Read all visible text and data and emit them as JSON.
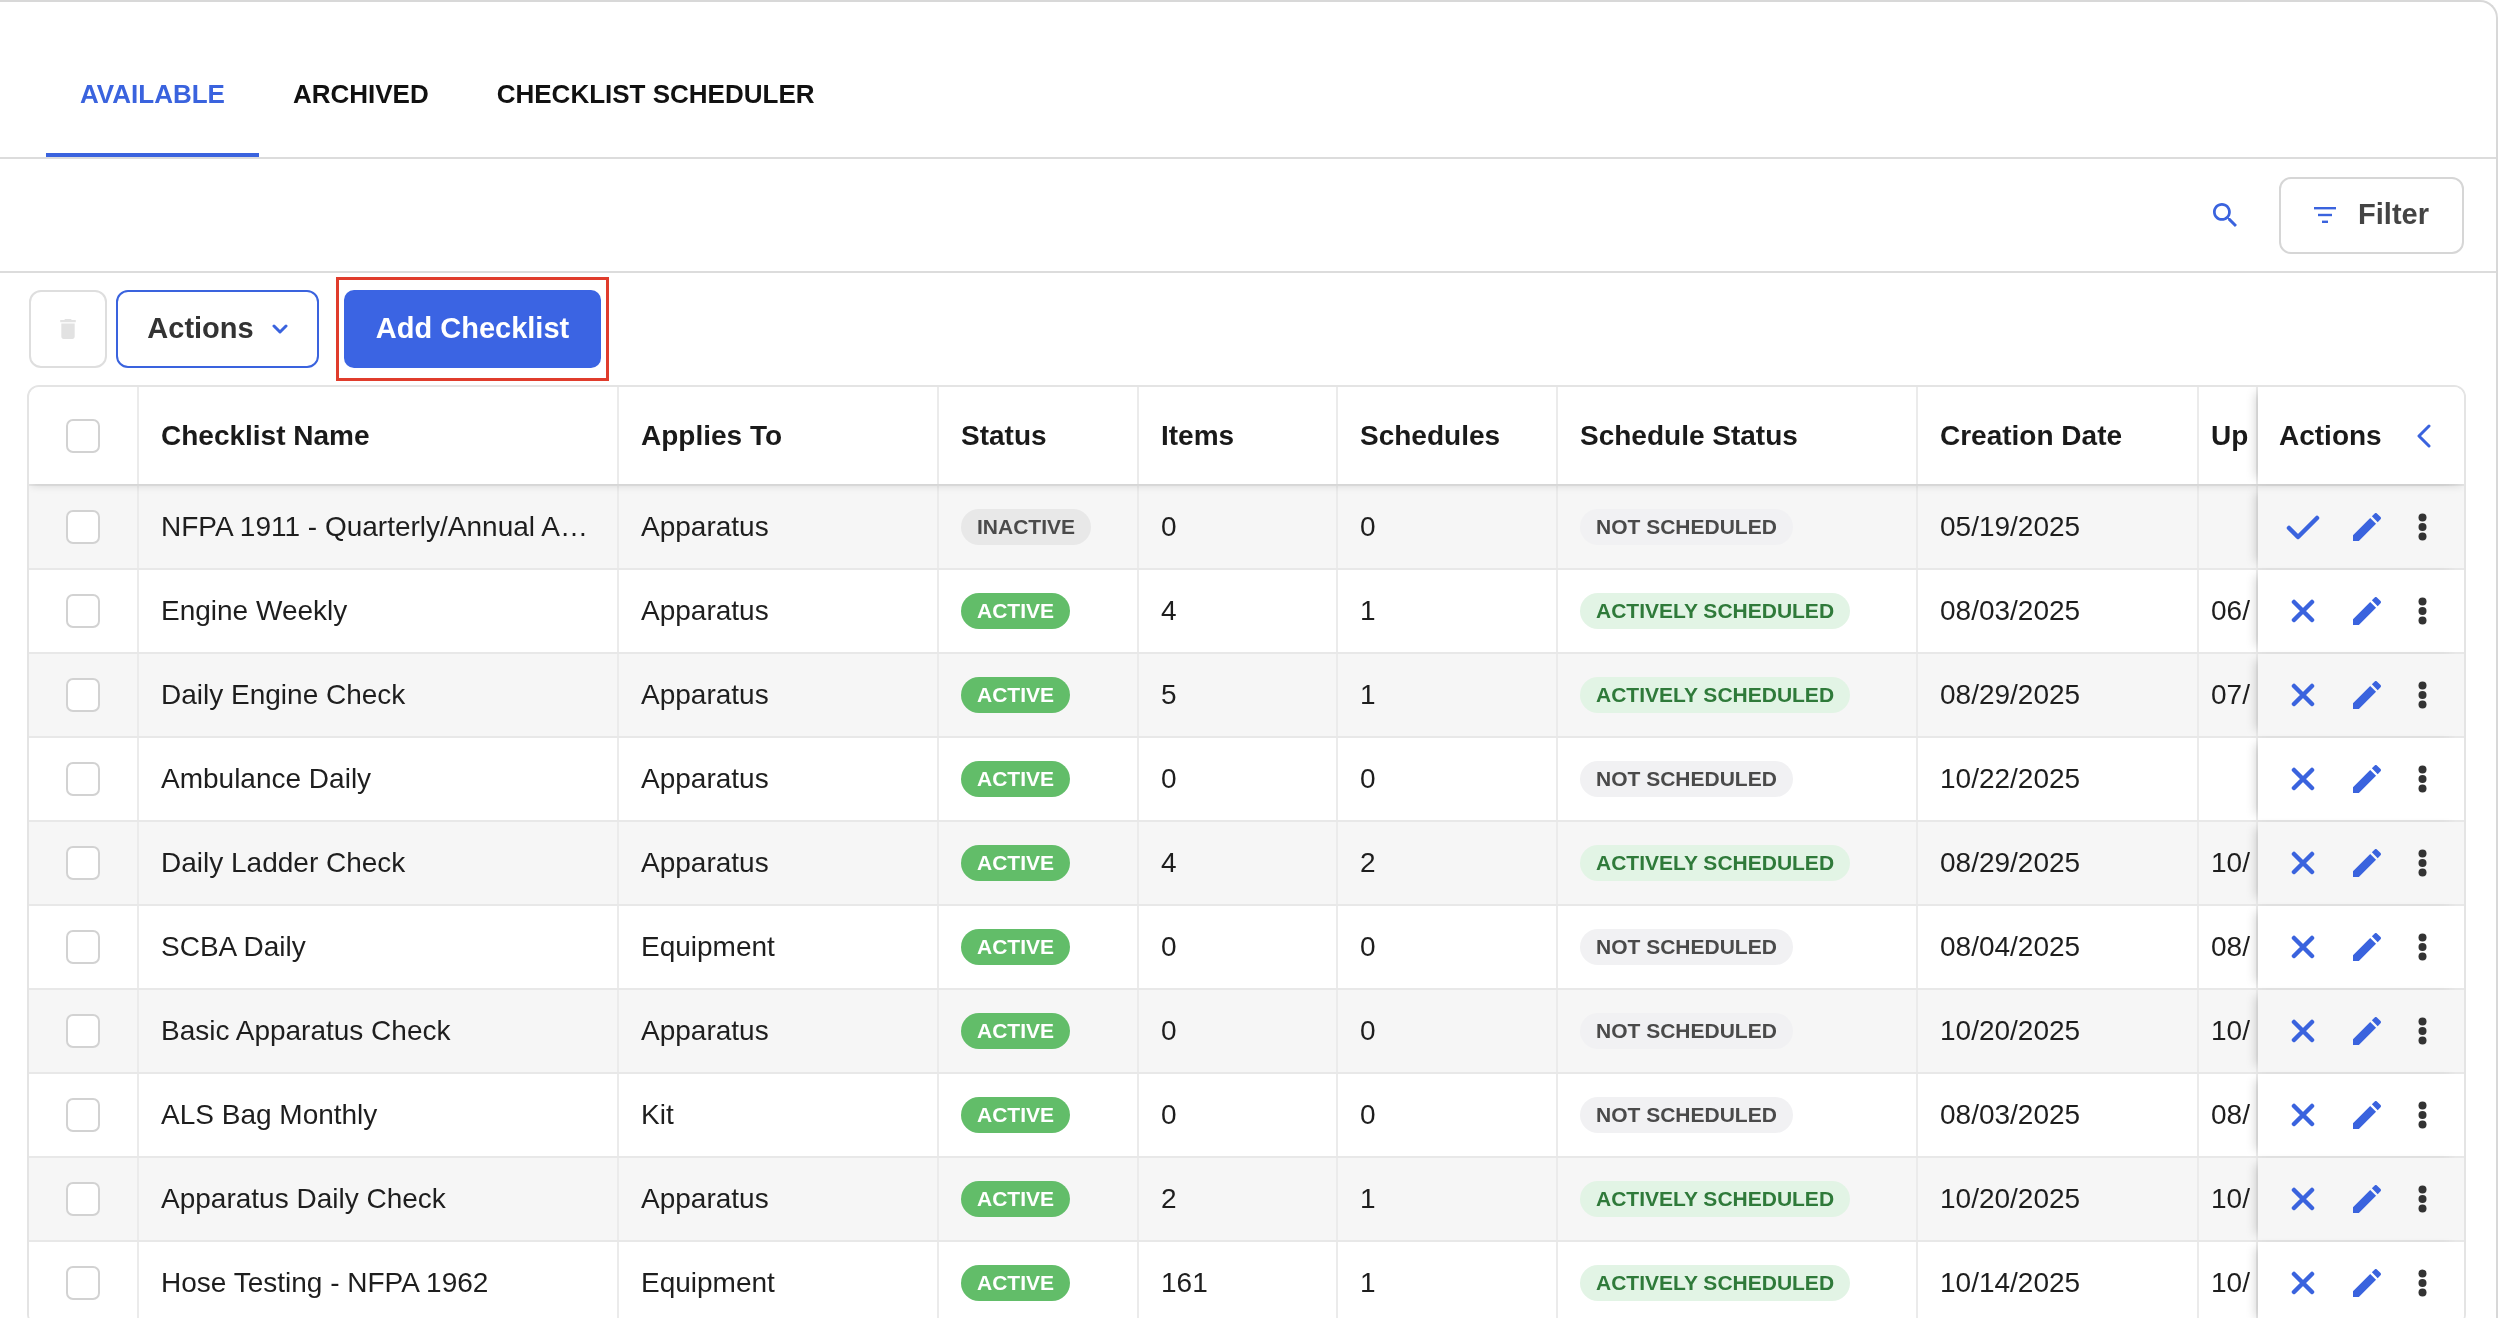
{
  "tabs": [
    {
      "label": "AVAILABLE",
      "selected": true
    },
    {
      "label": "ARCHIVED",
      "selected": false
    },
    {
      "label": "CHECKLIST SCHEDULER",
      "selected": false
    }
  ],
  "filter_button": {
    "label": "Filter"
  },
  "toolbar": {
    "delete_button": {
      "disabled": true
    },
    "actions_button": {
      "label": "Actions"
    },
    "add_button": {
      "label": "Add Checklist",
      "highlighted": true
    }
  },
  "table": {
    "select_all": {
      "checked": false
    },
    "columns": [
      "Checklist Name",
      "Applies To",
      "Status",
      "Items",
      "Schedules",
      "Schedule Status",
      "Creation Date",
      "Up",
      "Actions"
    ],
    "rows": [
      {
        "checked": false,
        "name": "NFPA 1911 - Quarterly/Annual A…",
        "applies_to": "Apparatus",
        "status": {
          "label": "INACTIVE",
          "active": false
        },
        "items": "0",
        "schedules": "0",
        "schedule_status": {
          "label": "NOT SCHEDULED",
          "scheduled": false
        },
        "creation_date": "05/19/2025"
      },
      {
        "checked": false,
        "name": "Engine Weekly",
        "applies_to": "Apparatus",
        "status": {
          "label": "ACTIVE",
          "active": true
        },
        "items": "4",
        "schedules": "1",
        "schedule_status": {
          "label": "ACTIVELY SCHEDULED",
          "scheduled": true
        },
        "creation_date": "08/03/2025",
        "column_8": "06/"
      },
      {
        "checked": false,
        "name": "Daily Engine Check",
        "applies_to": "Apparatus",
        "status": {
          "label": "ACTIVE",
          "active": true
        },
        "items": "5",
        "schedules": "1",
        "schedule_status": {
          "label": "ACTIVELY SCHEDULED",
          "scheduled": true
        },
        "creation_date": "08/29/2025",
        "column_8": "07/"
      },
      {
        "checked": false,
        "name": "Ambulance Daily",
        "applies_to": "Apparatus",
        "status": {
          "label": "ACTIVE",
          "active": true
        },
        "items": "0",
        "schedules": "0",
        "schedule_status": {
          "label": "NOT SCHEDULED",
          "scheduled": false
        },
        "creation_date": "10/22/2025"
      },
      {
        "checked": false,
        "name": "Daily Ladder Check",
        "applies_to": "Apparatus",
        "status": {
          "label": "ACTIVE",
          "active": true
        },
        "items": "4",
        "schedules": "2",
        "schedule_status": {
          "label": "ACTIVELY SCHEDULED",
          "scheduled": true
        },
        "creation_date": "08/29/2025",
        "column_8": "10/"
      },
      {
        "checked": false,
        "name": "SCBA Daily",
        "applies_to": "Equipment",
        "status": {
          "label": "ACTIVE",
          "active": true
        },
        "items": "0",
        "schedules": "0",
        "schedule_status": {
          "label": "NOT SCHEDULED",
          "scheduled": false
        },
        "creation_date": "08/04/2025",
        "column_8": "08/"
      },
      {
        "checked": false,
        "name": "Basic Apparatus Check",
        "applies_to": "Apparatus",
        "status": {
          "label": "ACTIVE",
          "active": true
        },
        "items": "0",
        "schedules": "0",
        "schedule_status": {
          "label": "NOT SCHEDULED",
          "scheduled": false
        },
        "creation_date": "10/20/2025",
        "column_8": "10/"
      },
      {
        "checked": false,
        "name": "ALS Bag Monthly",
        "applies_to": "Kit",
        "status": {
          "label": "ACTIVE",
          "active": true
        },
        "items": "0",
        "schedules": "0",
        "schedule_status": {
          "label": "NOT SCHEDULED",
          "scheduled": false
        },
        "creation_date": "08/03/2025",
        "column_8": "08/"
      },
      {
        "checked": false,
        "name": "Apparatus Daily Check",
        "applies_to": "Apparatus",
        "status": {
          "label": "ACTIVE",
          "active": true
        },
        "items": "2",
        "schedules": "1",
        "schedule_status": {
          "label": "ACTIVELY SCHEDULED",
          "scheduled": true
        },
        "creation_date": "10/20/2025",
        "column_8": "10/"
      },
      {
        "checked": false,
        "name": "Hose Testing - NFPA 1962",
        "applies_to": "Equipment",
        "status": {
          "label": "ACTIVE",
          "active": true
        },
        "items": "161",
        "schedules": "1",
        "schedule_status": {
          "label": "ACTIVELY SCHEDULED",
          "scheduled": true
        },
        "creation_date": "10/14/2025",
        "column_8": "10/"
      }
    ]
  }
}
